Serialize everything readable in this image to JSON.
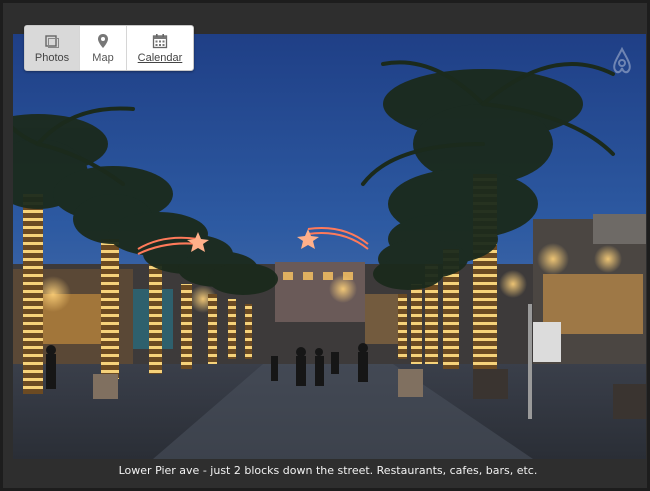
{
  "tabs": [
    {
      "label": "Photos",
      "icon": "photos-icon",
      "active": true
    },
    {
      "label": "Map",
      "icon": "map-pin-icon",
      "active": false
    },
    {
      "label": "Calendar",
      "icon": "calendar-icon",
      "active": false
    }
  ],
  "photo": {
    "subject": "street with lit palm trees at dusk"
  },
  "caption": "Lower Pier ave - just 2 blocks down the street. Restaurants, cafes, bars, etc.",
  "colors": {
    "background": "#2e2e2e",
    "sky": "#2a4f8e",
    "tree_lights": "#f2c86a",
    "caption_text": "#f2f2f2"
  }
}
